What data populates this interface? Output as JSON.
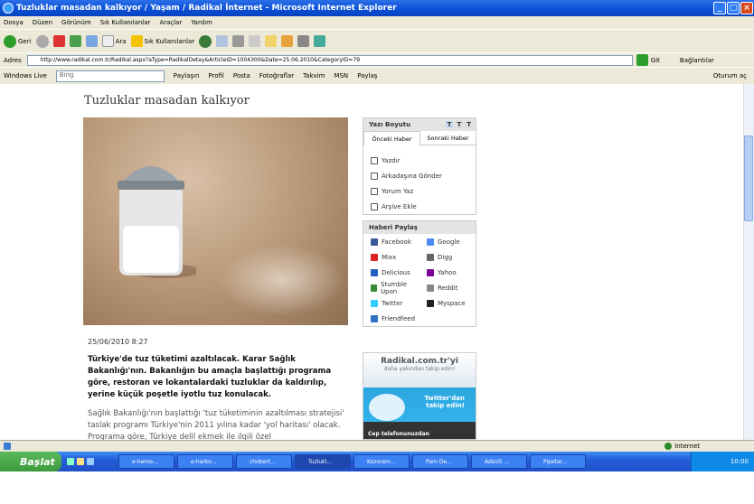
{
  "window": {
    "title": "Tuzluklar masadan kalkıyor / Yaşam / Radikal İnternet - Microsoft Internet Explorer"
  },
  "menu": [
    "Dosya",
    "Düzen",
    "Görünüm",
    "Sık Kullanılanlar",
    "Araçlar",
    "Yardım"
  ],
  "toolbar": {
    "back_label": "Geri",
    "search_label": "Ara",
    "favorites_label": "Sık Kullanılanlar"
  },
  "address": {
    "label": "Adres",
    "url": "http://www.radikal.com.tr/Radikal.aspx?aType=RadikalDetay&ArticleID=1004300&Date=25.06.2010&CategoryID=79",
    "go_label": "Git",
    "links_label": "Bağlantılar"
  },
  "linksbar": {
    "windows_live": "Windows Live",
    "search_placeholder": "Bing",
    "items": [
      "Paylaşın",
      "Profil",
      "Posta",
      "Fotoğraflar",
      "Takvim",
      "MSN",
      "Paylaş"
    ],
    "signin": "Oturum aç"
  },
  "article": {
    "title": "Tuzluklar masadan kalkıyor",
    "date": "25/06/2010 8:27",
    "lead": "Türkiye'de tuz tüketimi azaltılacak. Karar Sağlık Bakanlığı'nın. Bakanlığın bu amaçla başlattığı programa göre, restoran ve lokantalardaki tuzluklar da kaldırılıp, yerine küçük poşetle iyotlu tuz konulacak.",
    "body": "Sağlık Bakanlığı'nın başlattığı 'tuz tüketiminin azaltılması stratejisi' taslak programı Türkiye'nin 2011 yılına kadar 'yol haritası' olacak. Programa göre, Türkiye delil ekmek ile ilgili özel"
  },
  "sidebar": {
    "fontsize_label": "Yazı Boyutu",
    "font_buttons": [
      "T",
      "T",
      "T"
    ],
    "tabs": [
      "Önceki Haber",
      "Sonraki Haber"
    ],
    "tools": [
      "Yazdır",
      "Arkadaşına Gönder",
      "Yorum Yaz",
      "Arşive Ekle"
    ],
    "share_label": "Haberi Paylaş",
    "share": [
      {
        "label": "Facebook",
        "color": "#3b5998"
      },
      {
        "label": "Google",
        "color": "#4a8af4"
      },
      {
        "label": "Mixx",
        "color": "#d22"
      },
      {
        "label": "Digg",
        "color": "#666"
      },
      {
        "label": "Delicious",
        "color": "#225fc2"
      },
      {
        "label": "Yahoo",
        "color": "#7b0099"
      },
      {
        "label": "Stumble Upon",
        "color": "#3a8a3a"
      },
      {
        "label": "Reddit",
        "color": "#888"
      },
      {
        "label": "Twitter",
        "color": "#33ccff"
      },
      {
        "label": "Myspace",
        "color": "#222"
      },
      {
        "label": "Friendfeed",
        "color": "#2f72c4"
      }
    ]
  },
  "ad": {
    "brand": "Radikal.com.tr'yi",
    "tagline": "daha yakından takip edin!",
    "cta_line1": "Twitter'dan",
    "cta_line2": "takip edin!",
    "footer": "Cep telefonunuzdan"
  },
  "status": {
    "zone": "Internet"
  },
  "taskbar": {
    "start": "Başlat",
    "tasks": [
      "e-hemo...",
      "e-harko...",
      "chobert...",
      "Tuzlukl...",
      "Kozorem...",
      "Pam De...",
      "Adsiz5 ...",
      "Pipetar..."
    ],
    "active_index": 3,
    "clock": "10:00"
  }
}
